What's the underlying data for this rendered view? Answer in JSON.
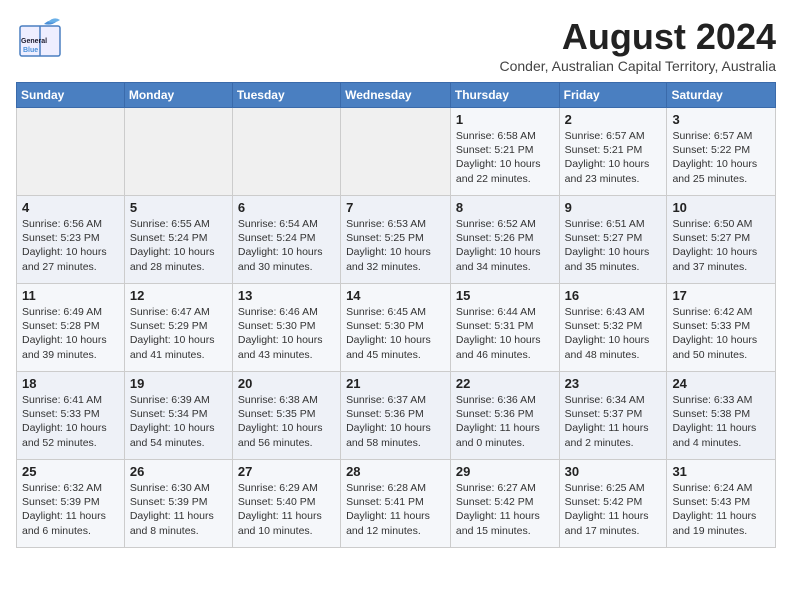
{
  "header": {
    "logo_general": "General",
    "logo_blue": "Blue",
    "month": "August 2024",
    "subtitle": "Conder, Australian Capital Territory, Australia"
  },
  "weekdays": [
    "Sunday",
    "Monday",
    "Tuesday",
    "Wednesday",
    "Thursday",
    "Friday",
    "Saturday"
  ],
  "weeks": [
    [
      {
        "day": "",
        "info": ""
      },
      {
        "day": "",
        "info": ""
      },
      {
        "day": "",
        "info": ""
      },
      {
        "day": "",
        "info": ""
      },
      {
        "day": "1",
        "info": "Sunrise: 6:58 AM\nSunset: 5:21 PM\nDaylight: 10 hours\nand 22 minutes."
      },
      {
        "day": "2",
        "info": "Sunrise: 6:57 AM\nSunset: 5:21 PM\nDaylight: 10 hours\nand 23 minutes."
      },
      {
        "day": "3",
        "info": "Sunrise: 6:57 AM\nSunset: 5:22 PM\nDaylight: 10 hours\nand 25 minutes."
      }
    ],
    [
      {
        "day": "4",
        "info": "Sunrise: 6:56 AM\nSunset: 5:23 PM\nDaylight: 10 hours\nand 27 minutes."
      },
      {
        "day": "5",
        "info": "Sunrise: 6:55 AM\nSunset: 5:24 PM\nDaylight: 10 hours\nand 28 minutes."
      },
      {
        "day": "6",
        "info": "Sunrise: 6:54 AM\nSunset: 5:24 PM\nDaylight: 10 hours\nand 30 minutes."
      },
      {
        "day": "7",
        "info": "Sunrise: 6:53 AM\nSunset: 5:25 PM\nDaylight: 10 hours\nand 32 minutes."
      },
      {
        "day": "8",
        "info": "Sunrise: 6:52 AM\nSunset: 5:26 PM\nDaylight: 10 hours\nand 34 minutes."
      },
      {
        "day": "9",
        "info": "Sunrise: 6:51 AM\nSunset: 5:27 PM\nDaylight: 10 hours\nand 35 minutes."
      },
      {
        "day": "10",
        "info": "Sunrise: 6:50 AM\nSunset: 5:27 PM\nDaylight: 10 hours\nand 37 minutes."
      }
    ],
    [
      {
        "day": "11",
        "info": "Sunrise: 6:49 AM\nSunset: 5:28 PM\nDaylight: 10 hours\nand 39 minutes."
      },
      {
        "day": "12",
        "info": "Sunrise: 6:47 AM\nSunset: 5:29 PM\nDaylight: 10 hours\nand 41 minutes."
      },
      {
        "day": "13",
        "info": "Sunrise: 6:46 AM\nSunset: 5:30 PM\nDaylight: 10 hours\nand 43 minutes."
      },
      {
        "day": "14",
        "info": "Sunrise: 6:45 AM\nSunset: 5:30 PM\nDaylight: 10 hours\nand 45 minutes."
      },
      {
        "day": "15",
        "info": "Sunrise: 6:44 AM\nSunset: 5:31 PM\nDaylight: 10 hours\nand 46 minutes."
      },
      {
        "day": "16",
        "info": "Sunrise: 6:43 AM\nSunset: 5:32 PM\nDaylight: 10 hours\nand 48 minutes."
      },
      {
        "day": "17",
        "info": "Sunrise: 6:42 AM\nSunset: 5:33 PM\nDaylight: 10 hours\nand 50 minutes."
      }
    ],
    [
      {
        "day": "18",
        "info": "Sunrise: 6:41 AM\nSunset: 5:33 PM\nDaylight: 10 hours\nand 52 minutes."
      },
      {
        "day": "19",
        "info": "Sunrise: 6:39 AM\nSunset: 5:34 PM\nDaylight: 10 hours\nand 54 minutes."
      },
      {
        "day": "20",
        "info": "Sunrise: 6:38 AM\nSunset: 5:35 PM\nDaylight: 10 hours\nand 56 minutes."
      },
      {
        "day": "21",
        "info": "Sunrise: 6:37 AM\nSunset: 5:36 PM\nDaylight: 10 hours\nand 58 minutes."
      },
      {
        "day": "22",
        "info": "Sunrise: 6:36 AM\nSunset: 5:36 PM\nDaylight: 11 hours\nand 0 minutes."
      },
      {
        "day": "23",
        "info": "Sunrise: 6:34 AM\nSunset: 5:37 PM\nDaylight: 11 hours\nand 2 minutes."
      },
      {
        "day": "24",
        "info": "Sunrise: 6:33 AM\nSunset: 5:38 PM\nDaylight: 11 hours\nand 4 minutes."
      }
    ],
    [
      {
        "day": "25",
        "info": "Sunrise: 6:32 AM\nSunset: 5:39 PM\nDaylight: 11 hours\nand 6 minutes."
      },
      {
        "day": "26",
        "info": "Sunrise: 6:30 AM\nSunset: 5:39 PM\nDaylight: 11 hours\nand 8 minutes."
      },
      {
        "day": "27",
        "info": "Sunrise: 6:29 AM\nSunset: 5:40 PM\nDaylight: 11 hours\nand 10 minutes."
      },
      {
        "day": "28",
        "info": "Sunrise: 6:28 AM\nSunset: 5:41 PM\nDaylight: 11 hours\nand 12 minutes."
      },
      {
        "day": "29",
        "info": "Sunrise: 6:27 AM\nSunset: 5:42 PM\nDaylight: 11 hours\nand 15 minutes."
      },
      {
        "day": "30",
        "info": "Sunrise: 6:25 AM\nSunset: 5:42 PM\nDaylight: 11 hours\nand 17 minutes."
      },
      {
        "day": "31",
        "info": "Sunrise: 6:24 AM\nSunset: 5:43 PM\nDaylight: 11 hours\nand 19 minutes."
      }
    ]
  ]
}
